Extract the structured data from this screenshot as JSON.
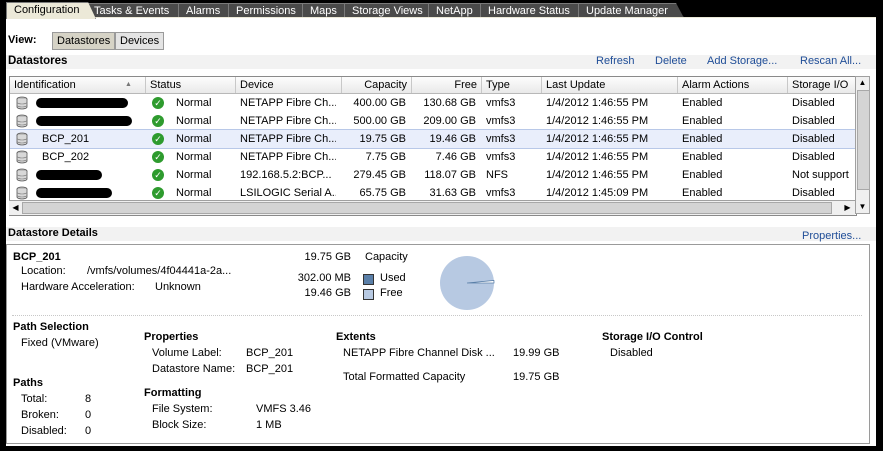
{
  "tabs": [
    "Configuration",
    "Tasks & Events",
    "Alarms",
    "Permissions",
    "Maps",
    "Storage Views",
    "NetApp",
    "Hardware Status",
    "Update Manager"
  ],
  "active_tab": "Configuration",
  "view": {
    "label": "View:",
    "buttons": [
      "Datastores",
      "Devices"
    ],
    "selected": "Datastores"
  },
  "datastores": {
    "title": "Datastores",
    "actions": [
      "Refresh",
      "Delete",
      "Add Storage...",
      "Rescan All..."
    ],
    "columns": [
      "Identification",
      "Status",
      "Device",
      "Capacity",
      "Free",
      "Type",
      "Last Update",
      "Alarm Actions",
      "Storage I/O"
    ],
    "rows": [
      {
        "id": "",
        "redacted": true,
        "status": "Normal",
        "device": "NETAPP Fibre Ch...",
        "capacity": "400.00 GB",
        "free": "130.68 GB",
        "type": "vmfs3",
        "last_update": "1/4/2012 1:46:55 PM",
        "alarm": "Enabled",
        "sio": "Disabled"
      },
      {
        "id": "",
        "redacted": true,
        "status": "Normal",
        "device": "NETAPP Fibre Ch...",
        "capacity": "500.00 GB",
        "free": "209.00 GB",
        "type": "vmfs3",
        "last_update": "1/4/2012 1:46:55 PM",
        "alarm": "Enabled",
        "sio": "Disabled"
      },
      {
        "id": "BCP_201",
        "redacted": false,
        "status": "Normal",
        "device": "NETAPP Fibre Ch...",
        "capacity": "19.75 GB",
        "free": "19.46 GB",
        "type": "vmfs3",
        "last_update": "1/4/2012 1:46:55 PM",
        "alarm": "Enabled",
        "sio": "Disabled"
      },
      {
        "id": "BCP_202",
        "redacted": false,
        "status": "Normal",
        "device": "NETAPP Fibre Ch...",
        "capacity": "7.75 GB",
        "free": "7.46 GB",
        "type": "vmfs3",
        "last_update": "1/4/2012 1:46:55 PM",
        "alarm": "Enabled",
        "sio": "Disabled"
      },
      {
        "id": "",
        "redacted": true,
        "status": "Normal",
        "device": "192.168.5.2:BCP...",
        "capacity": "279.45 GB",
        "free": "118.07 GB",
        "type": "NFS",
        "last_update": "1/4/2012 1:46:55 PM",
        "alarm": "Enabled",
        "sio": "Not support"
      },
      {
        "id": "",
        "redacted": true,
        "status": "Normal",
        "device": "LSILOGIC Serial A...",
        "capacity": "65.75 GB",
        "free": "31.63 GB",
        "type": "vmfs3",
        "last_update": "1/4/2012 1:45:09 PM",
        "alarm": "Enabled",
        "sio": "Disabled"
      }
    ],
    "selected_row": 2
  },
  "details": {
    "title": "Datastore Details",
    "properties_link": "Properties...",
    "name": "BCP_201",
    "capacity_value": "19.75 GB",
    "capacity_label": "Capacity",
    "location_label": "Location:",
    "location_value": "/vmfs/volumes/4f04441a-2a...",
    "hwaccel_label": "Hardware Acceleration:",
    "hwaccel_value": "Unknown",
    "used_value": "302.00 MB",
    "used_label": "Used",
    "free_value": "19.46 GB",
    "free_label": "Free",
    "used_fraction": 0.015,
    "colors": {
      "used": "#5a7fa8",
      "free": "#b7c9e2"
    },
    "path_selection": {
      "title": "Path Selection",
      "value": "Fixed (VMware)"
    },
    "paths": {
      "title": "Paths",
      "total_label": "Total:",
      "total": "8",
      "broken_label": "Broken:",
      "broken": "0",
      "disabled_label": "Disabled:",
      "disabled": "0"
    },
    "properties": {
      "title": "Properties",
      "volume_label_label": "Volume Label:",
      "volume_label": "BCP_201",
      "datastore_name_label": "Datastore Name:",
      "datastore_name": "BCP_201"
    },
    "formatting": {
      "title": "Formatting",
      "fs_label": "File System:",
      "fs": "VMFS 3.46",
      "block_label": "Block Size:",
      "block": "1 MB"
    },
    "extents": {
      "title": "Extents",
      "disk": "NETAPP Fibre Channel Disk ...",
      "disk_size": "19.99 GB",
      "total_label": "Total Formatted Capacity",
      "total": "19.75 GB"
    },
    "sioc": {
      "title": "Storage I/O Control",
      "value": "Disabled"
    }
  }
}
